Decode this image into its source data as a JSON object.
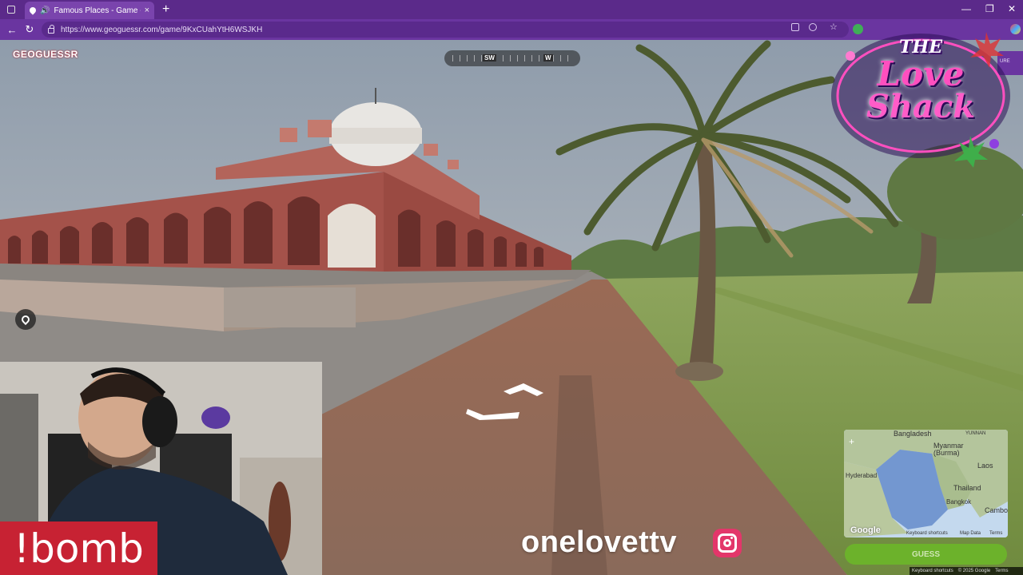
{
  "browser": {
    "tab_title": "Famous Places - Game - Ge",
    "url": "https://www.geoguessr.com/game/9KxCUahYtH6WSJKH",
    "new_tab_label": "+",
    "close_tab_label": "×",
    "window_controls": {
      "minimize": "—",
      "maximize": "❐",
      "close": "✕"
    }
  },
  "game": {
    "logo": "GEOGUESSR",
    "compass": {
      "left_label": "SW",
      "right_label": "W"
    },
    "side_tag": "URE",
    "guess_button": "GUESS"
  },
  "minimap": {
    "labels": {
      "bangladesh": "Bangladesh",
      "myanmar": "Myanmar\n(Burma)",
      "laos": "Laos",
      "hyderabad": "Hyderabad",
      "thailand": "Thailand",
      "bangkok": "Bangkok",
      "cambo": "Cambo",
      "yunnan": "YUNNAN"
    },
    "google_logo": "Google",
    "footer": {
      "shortcuts": "Keyboard shortcuts",
      "mapdata": "Map Data",
      "terms": "Terms"
    }
  },
  "bottom_bar": {
    "shortcuts": "Keyboard shortcuts",
    "copyright": "© 2025 Google",
    "terms": "Terms"
  },
  "overlay": {
    "brand": {
      "line1": "THE",
      "line2": "Love",
      "line3": "Shack"
    },
    "handle": "onelovettv",
    "command": "!bomb"
  },
  "colors": {
    "chrome_purple": "#5b2a8a",
    "guess_green": "#6cb928",
    "bomb_red": "#c72233",
    "instagram_pink": "#e3366a"
  }
}
